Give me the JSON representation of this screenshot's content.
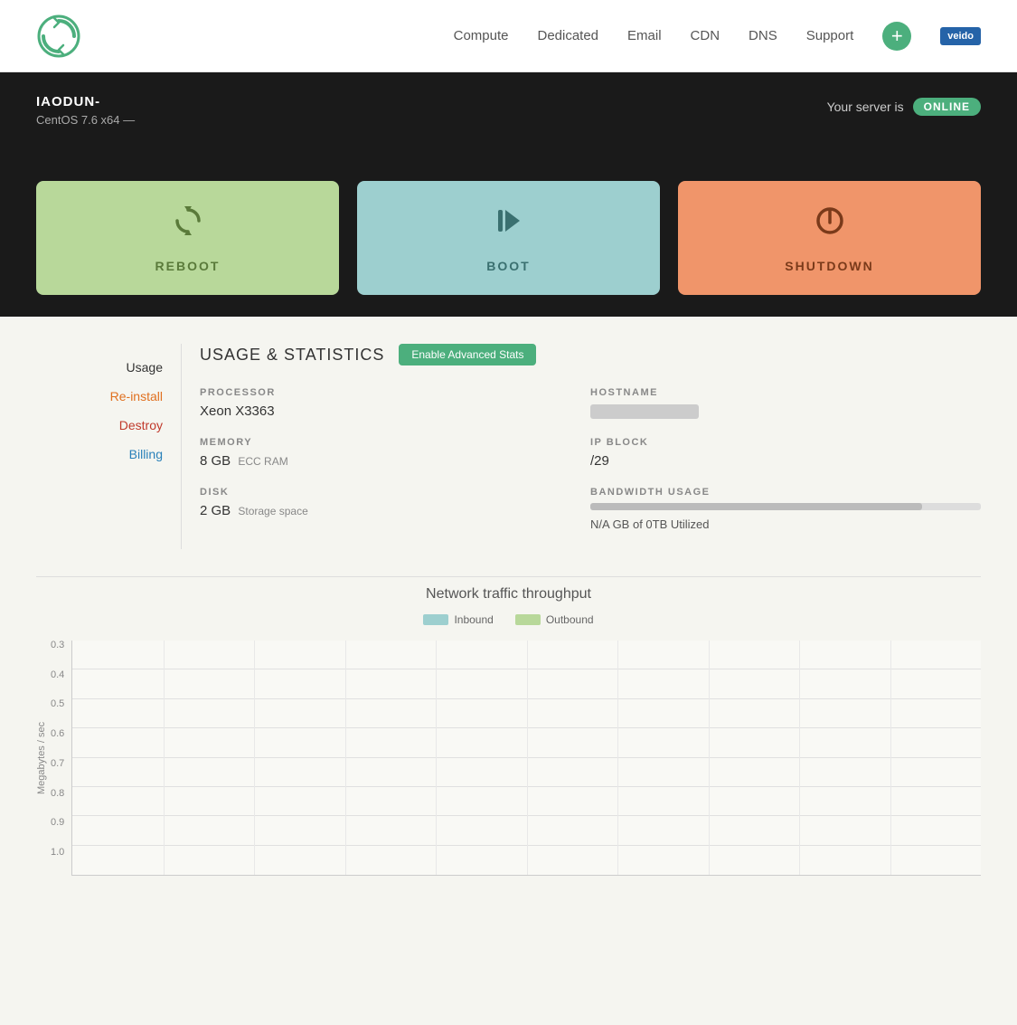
{
  "header": {
    "nav": {
      "compute": "Compute",
      "dedicated": "Dedicated",
      "email": "Email",
      "cdn": "CDN",
      "dns": "DNS",
      "support": "Support",
      "add_btn_label": "+",
      "brand_label": "veido"
    }
  },
  "server_banner": {
    "title": "IAODUN-",
    "os": "CentOS 7.6 x64 —",
    "status_prefix": "Your server is",
    "status": "ONLINE"
  },
  "actions": {
    "reboot": "REBOOT",
    "boot": "BOOT",
    "shutdown": "SHUTDOWN"
  },
  "sidebar": {
    "items": [
      {
        "label": "Usage",
        "style": "active"
      },
      {
        "label": "Re-install",
        "style": "orange"
      },
      {
        "label": "Destroy",
        "style": "red"
      },
      {
        "label": "Billing",
        "style": "blue"
      }
    ]
  },
  "stats": {
    "title": "USAGE & STATISTICS",
    "enable_btn": "Enable Advanced Stats",
    "processor_label": "PROCESSOR",
    "processor_value": "Xeon X3363",
    "memory_label": "MEMORY",
    "memory_value": "8 GB",
    "memory_unit": "ECC RAM",
    "disk_label": "DISK",
    "disk_value": "2 GB",
    "disk_unit": "Storage space",
    "hostname_label": "HOSTNAME",
    "ipblock_label": "IP BLOCK",
    "ipblock_value": "/29",
    "bandwidth_label": "BANDWIDTH USAGE",
    "bandwidth_text": "N/A GB of 0TB Utilized"
  },
  "chart": {
    "title": "Network traffic throughput",
    "legend_inbound": "Inbound",
    "legend_outbound": "Outbound",
    "y_title": "Megabytes / sec",
    "y_labels": [
      "0.3",
      "0.4",
      "0.5",
      "0.6",
      "0.7",
      "0.8",
      "0.9",
      "1.0"
    ]
  }
}
